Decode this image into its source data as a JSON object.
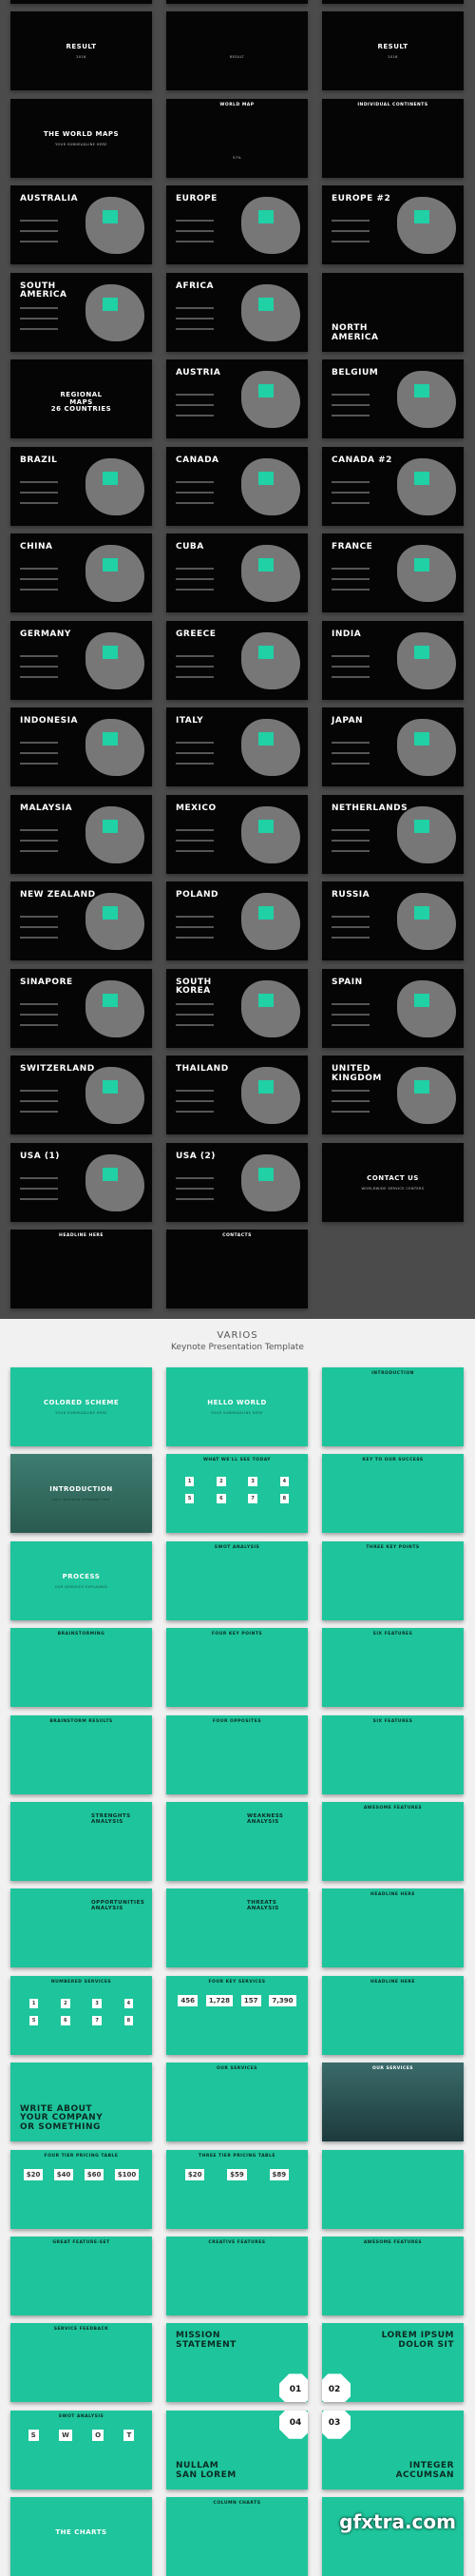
{
  "colors": {
    "dark_bg": "#4b4b4b",
    "slide_dark": "#050505",
    "accent": "#1ec49b",
    "light_bg": "#f1f1f1"
  },
  "header": {
    "title": "VARIOS",
    "subtitle": "Keynote Presentation Template"
  },
  "watermark": "gfxtra.com",
  "dark_slides": [
    {
      "title": "",
      "kind": "hero",
      "sub": "RESULT"
    },
    {
      "title": "",
      "kind": "hero",
      "sub": "RESULT"
    },
    {
      "title": "",
      "kind": "hero",
      "sub": "RESULT"
    },
    {
      "title": "RESULT",
      "kind": "hero",
      "sub": "2016"
    },
    {
      "title": "",
      "kind": "hero",
      "sub": "RESULT"
    },
    {
      "title": "RESULT",
      "kind": "hero",
      "sub": "2016"
    },
    {
      "title": "THE WORLD MAPS",
      "kind": "hero",
      "sub": "YOUR SUBHEADLINE HERE"
    },
    {
      "title": "WORLD MAP",
      "kind": "top",
      "sub": "57%"
    },
    {
      "title": "INDIVIDUAL CONTINENTS",
      "kind": "top"
    },
    {
      "title": "AUSTRALIA",
      "kind": "map"
    },
    {
      "title": "EUROPE",
      "kind": "map"
    },
    {
      "title": "EUROPE #2",
      "kind": "map"
    },
    {
      "title": "SOUTH\nAMERICA",
      "kind": "map"
    },
    {
      "title": "AFRICA",
      "kind": "map"
    },
    {
      "title": "NORTH\nAMERICA",
      "kind": "bigb"
    },
    {
      "title": "REGIONAL\nMAPS\n26 COUNTRIES",
      "kind": "hero"
    },
    {
      "title": "AUSTRIA",
      "kind": "map"
    },
    {
      "title": "BELGIUM",
      "kind": "map"
    },
    {
      "title": "BRAZIL",
      "kind": "map"
    },
    {
      "title": "CANADA",
      "kind": "map"
    },
    {
      "title": "CANADA #2",
      "kind": "map"
    },
    {
      "title": "CHINA",
      "kind": "map"
    },
    {
      "title": "CUBA",
      "kind": "map"
    },
    {
      "title": "FRANCE",
      "kind": "map"
    },
    {
      "title": "GERMANY",
      "kind": "map"
    },
    {
      "title": "GREECE",
      "kind": "map"
    },
    {
      "title": "INDIA",
      "kind": "map"
    },
    {
      "title": "INDONESIA",
      "kind": "map"
    },
    {
      "title": "ITALY",
      "kind": "map"
    },
    {
      "title": "JAPAN",
      "kind": "map"
    },
    {
      "title": "MALAYSIA",
      "kind": "map"
    },
    {
      "title": "MEXICO",
      "kind": "map"
    },
    {
      "title": "NETHERLANDS",
      "kind": "map"
    },
    {
      "title": "NEW ZEALAND",
      "kind": "map"
    },
    {
      "title": "POLAND",
      "kind": "map"
    },
    {
      "title": "RUSSIA",
      "kind": "map"
    },
    {
      "title": "SINAPORE",
      "kind": "map"
    },
    {
      "title": "SOUTH\nKOREA",
      "kind": "map"
    },
    {
      "title": "SPAIN",
      "kind": "map"
    },
    {
      "title": "SWITZERLAND",
      "kind": "map"
    },
    {
      "title": "THAILAND",
      "kind": "map"
    },
    {
      "title": "UNITED\nKINGDOM",
      "kind": "map"
    },
    {
      "title": "USA (1)",
      "kind": "map"
    },
    {
      "title": "USA (2)",
      "kind": "map"
    },
    {
      "title": "CONTACT US",
      "kind": "hero",
      "sub": "WORLDWIDE SERVICE CENTERS"
    },
    {
      "title": "HEADLINE HERE",
      "kind": "top"
    },
    {
      "title": "CONTACTS",
      "kind": "top"
    }
  ],
  "green_slides": [
    {
      "title": "COLORED SCHEME",
      "kind": "hero",
      "sub": "YOUR SUBHEADLINE HERE"
    },
    {
      "title": "HELLO WORLD",
      "kind": "hero",
      "sub": "YOUR SUBHEADLINE HERE"
    },
    {
      "title": "INTRODUCTION",
      "kind": "top"
    },
    {
      "title": "INTRODUCTION",
      "kind": "hero",
      "style": "photo",
      "sub": "your welcome message here"
    },
    {
      "title": "WHAT WE'LL SEE TODAY",
      "kind": "top",
      "extra": [
        "1",
        "2",
        "3",
        "4",
        "5",
        "6",
        "7",
        "8"
      ]
    },
    {
      "title": "KEY TO OUR SUCCESS",
      "kind": "top"
    },
    {
      "title": "PROCESS",
      "kind": "hero",
      "sub": "OUR SERVICES EXPLAINED"
    },
    {
      "title": "SWOT ANALYSIS",
      "kind": "top"
    },
    {
      "title": "THREE KEY POINTS",
      "kind": "top"
    },
    {
      "title": "BRAINSTORMING",
      "kind": "top"
    },
    {
      "title": "FOUR KEY POINTS",
      "kind": "top"
    },
    {
      "title": "SIX FEATURES",
      "kind": "top"
    },
    {
      "title": "BRAINSTORM RESULTS",
      "kind": "top"
    },
    {
      "title": "FOUR OPPOSITES",
      "kind": "top"
    },
    {
      "title": "SIX FEATURES",
      "kind": "top"
    },
    {
      "title": "STRENGHTS\nANALYSIS",
      "kind": "side"
    },
    {
      "title": "WEAKNESS\nANALYSIS",
      "kind": "side"
    },
    {
      "title": "AWESOME FEATURES",
      "kind": "top"
    },
    {
      "title": "OPPORTUNITIES\nANALYSIS",
      "kind": "side"
    },
    {
      "title": "THREATS\nANALYSIS",
      "kind": "side"
    },
    {
      "title": "HEADLINE HERE",
      "kind": "top"
    },
    {
      "title": "NUMBERED SERVICES",
      "kind": "top",
      "extra": [
        "1",
        "2",
        "3",
        "4",
        "5",
        "6",
        "7",
        "8"
      ]
    },
    {
      "title": "FOUR KEY SERVICES",
      "kind": "top",
      "extra": [
        "456",
        "1,728",
        "157",
        "7,390"
      ]
    },
    {
      "title": "HEADLINE HERE",
      "kind": "top"
    },
    {
      "title": "WRITE ABOUT\nYOUR COMPANY\nOR SOMETHING",
      "kind": "bigb"
    },
    {
      "title": "OUR SERVICES",
      "kind": "top"
    },
    {
      "title": "OUR SERVICES",
      "kind": "top",
      "style": "darkphoto"
    },
    {
      "title": "FOUR TIER PRICING TABLE",
      "kind": "top",
      "extra": [
        "$20",
        "$40",
        "$60",
        "$100"
      ]
    },
    {
      "title": "THREE TIER PRICING TABLE",
      "kind": "top",
      "extra": [
        "$20",
        "$59",
        "$89"
      ]
    },
    {
      "title": "",
      "kind": "top"
    },
    {
      "title": "GREAT FEATURE-SET",
      "kind": "top"
    },
    {
      "title": "CREATIVE FEATURES",
      "kind": "top"
    },
    {
      "title": "AWESOME FEATURES",
      "kind": "top"
    },
    {
      "title": "SERVICE FEEDBACK",
      "kind": "top"
    },
    {
      "title": "MISSION\nSTATEMENT",
      "kind": "big",
      "num": "01",
      "corner": "br"
    },
    {
      "title": "LOREM IPSUM\nDOLOR SIT",
      "kind": "bigr",
      "num": "02",
      "corner": "bl"
    },
    {
      "title": "SWOT ANALYSIS",
      "kind": "top",
      "extra": [
        "S",
        "W",
        "O",
        "T"
      ]
    },
    {
      "title": "NULLAM\nSAN LOREM",
      "kind": "bigb",
      "num": "04",
      "corner": "tr"
    },
    {
      "title": "INTEGER\nACCUMSAN",
      "kind": "bigrb",
      "num": "03",
      "corner": "tl"
    },
    {
      "title": "THE CHARTS",
      "kind": "hero"
    },
    {
      "title": "COLUMN CHARTS",
      "kind": "top"
    },
    {
      "title": "",
      "kind": "top"
    }
  ]
}
